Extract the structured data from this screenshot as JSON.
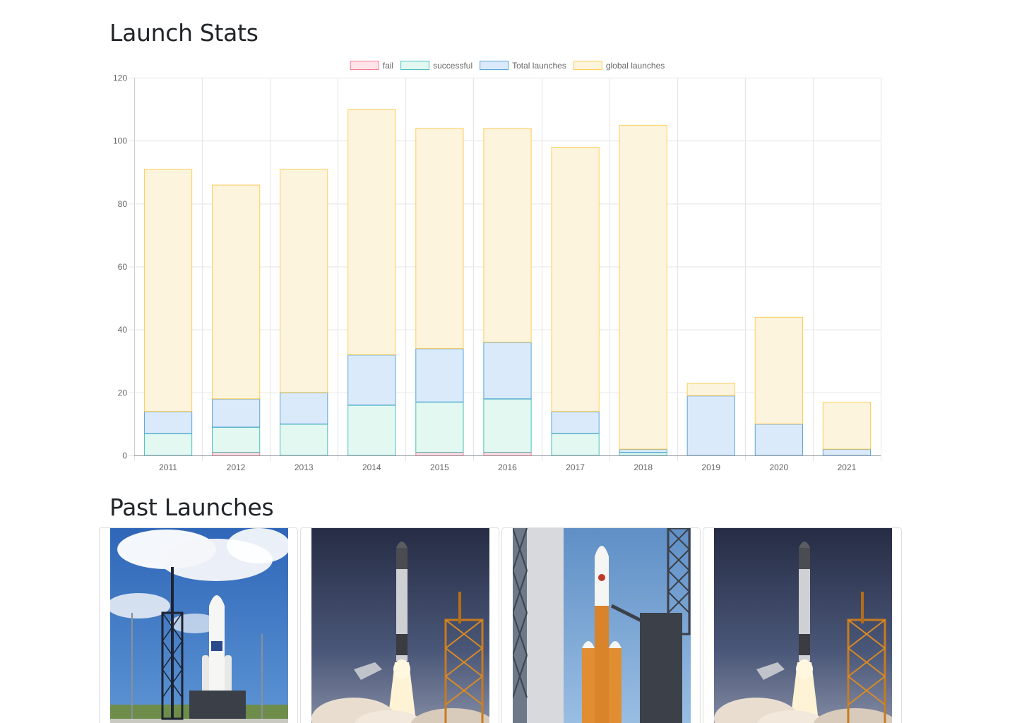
{
  "headings": {
    "stats": "Launch Stats",
    "past": "Past Launches"
  },
  "chart_data": {
    "type": "bar",
    "stacked": true,
    "categories": [
      "2011",
      "2012",
      "2013",
      "2014",
      "2015",
      "2016",
      "2017",
      "2018",
      "2019",
      "2020",
      "2021"
    ],
    "series": [
      {
        "name": "fail",
        "values": [
          0,
          1,
          0,
          0,
          1,
          1,
          0,
          0,
          0,
          0,
          0
        ],
        "fill": "#ffe4e9",
        "stroke": "#ff7a93"
      },
      {
        "name": "successful",
        "values": [
          7,
          8,
          10,
          16,
          16,
          17,
          7,
          1,
          0,
          0,
          0
        ],
        "fill": "#e2f8f1",
        "stroke": "#4bc0c0"
      },
      {
        "name": "Total launches",
        "values": [
          7,
          9,
          10,
          16,
          17,
          18,
          7,
          1,
          19,
          10,
          2
        ],
        "fill": "#dbeafa",
        "stroke": "#5aa4d8"
      },
      {
        "name": "global launches",
        "values": [
          77,
          68,
          71,
          78,
          70,
          68,
          84,
          103,
          4,
          34,
          15
        ],
        "fill": "#fdf4de",
        "stroke": "#ffcd56"
      }
    ],
    "yticks": [
      "0",
      "20",
      "40",
      "60",
      "80",
      "100",
      "120"
    ],
    "ylim": [
      0,
      120
    ],
    "grid": true,
    "legend": "top-center"
  },
  "launches": [
    {
      "image": "atlas-v-on-pad-photo"
    },
    {
      "image": "falcon-9-liftoff-photo"
    },
    {
      "image": "delta-iv-heavy-on-pad-photo"
    },
    {
      "image": "falcon-9-liftoff-photo"
    }
  ]
}
